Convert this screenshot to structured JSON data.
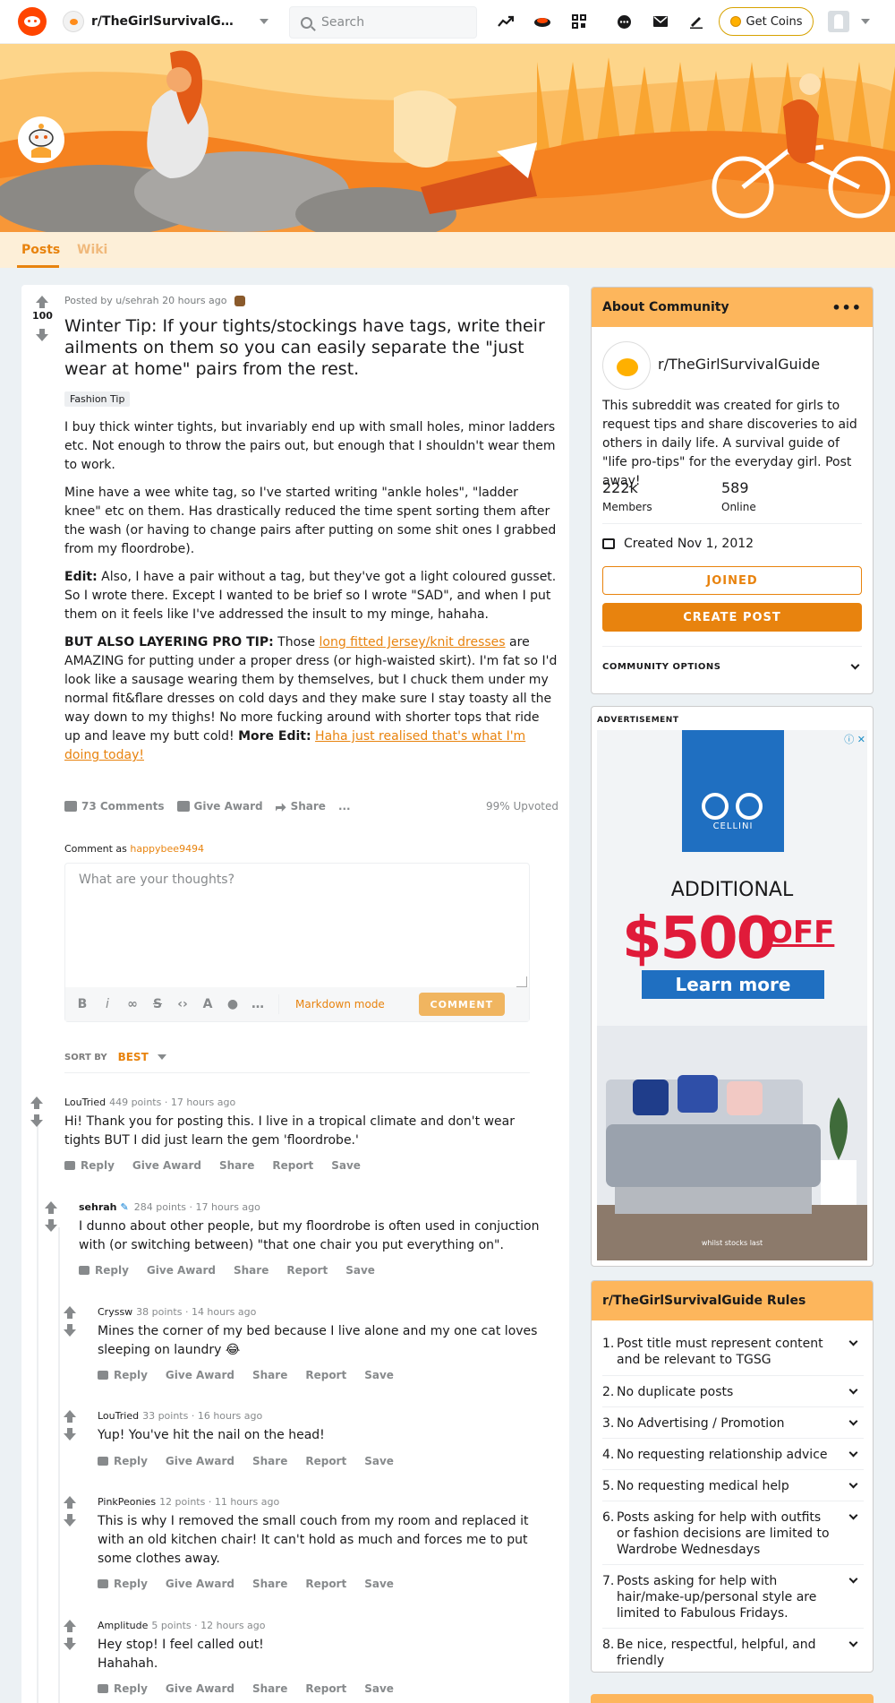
{
  "header": {
    "community": "r/TheGirlSurvivalGuide",
    "search_placeholder": "Search",
    "coins_label": "Get Coins"
  },
  "tabs": {
    "posts": "Posts",
    "wiki": "Wiki"
  },
  "post": {
    "score": "100",
    "posted_by": "Posted by u/sehrah 20 hours ago",
    "title": "Winter Tip: If your tights/stockings have tags, write their ailments on them so you can easily separate the \"just wear at home\" pairs from the rest.",
    "flair": "Fashion Tip",
    "p1": "I buy thick winter tights, but invariably end up with small holes, minor ladders etc. Not enough to throw the pairs out, but enough that I shouldn't wear them to work.",
    "p2": "Mine have a wee white tag, so I've started writing \"ankle holes\", \"ladder knee\" etc on them. Has drastically reduced the time spent sorting them after the wash (or having to change pairs after putting on some shit ones I grabbed from my floordrobe).",
    "p3_bold": "Edit:",
    "p3": " Also, I have a pair without a tag, but they've got a light coloured gusset. So I wrote there. Except I wanted to be brief so I wrote \"SAD\", and when I put them on it feels like I've addressed the insult to my minge, hahaha.",
    "p4_bold": "BUT ALSO LAYERING PRO TIP:",
    "p4_a": " Those ",
    "p4_link": "long fitted Jersey/knit dresses",
    "p4_b": " are AMAZING for putting under a proper dress (or high-waisted skirt). I'm fat so I'd look like a sausage wearing them by themselves, but I chuck them under my normal fit&flare dresses on cold days and they make sure I stay toasty all the way down to my thighs! No more fucking around with shorter tops that ride up and leave my butt cold! ",
    "p4_bold2": "More Edit:",
    "p4_link2": "Haha just realised that's what I'm doing today!",
    "comments_label": "73 Comments",
    "give_award": "Give Award",
    "share": "Share",
    "more": "...",
    "upvoted": "99% Upvoted"
  },
  "composer": {
    "comment_as": "Comment as ",
    "username": "happybee9494",
    "placeholder": "What are your thoughts?",
    "markdown": "Markdown mode",
    "submit": "COMMENT"
  },
  "sort": {
    "label": "SORT BY",
    "value": "BEST"
  },
  "comment_actions": {
    "reply": "Reply",
    "award": "Give Award",
    "share": "Share",
    "report": "Report",
    "save": "Save"
  },
  "comments": [
    {
      "author": "LouTried",
      "meta": "449 points · 17 hours ago",
      "lines": [
        "Hi! Thank you for posting this. I live in a tropical climate and don't wear",
        "tights BUT I did just learn the gem 'floordrobe.'"
      ]
    },
    {
      "author": "sehrah",
      "meta": "284 points · 17 hours ago",
      "lines": [
        "I dunno about other people, but my floordrobe is often used in conjuction",
        "with (or switching between) \"that one chair you put everything on\"."
      ]
    },
    {
      "author": "Cryssw",
      "meta": "38 points · 14 hours ago",
      "lines": [
        "Mines the corner of my bed because I live alone and my one cat loves",
        "sleeping on laundry 😂"
      ]
    },
    {
      "author": "LouTried",
      "meta": "33 points · 16 hours ago",
      "lines": [
        "Yup! You've hit the nail on the head!"
      ]
    },
    {
      "author": "PinkPeonies",
      "meta": "12 points · 11 hours ago",
      "lines": [
        "This is why I removed the small couch from my room and replaced it",
        "with an old kitchen chair! It can't hold as much and forces me to put",
        "some clothes away."
      ]
    },
    {
      "author": "Amplitude",
      "meta": "5 points · 12 hours ago",
      "lines": [
        "Hey stop! I feel called out!",
        "Hahahah."
      ]
    }
  ],
  "about": {
    "title": "About Community",
    "name": "r/TheGirlSurvivalGuide",
    "description": "This subreddit was created for girls to request tips and share discoveries to aid others in daily life. A survival guide of \"life pro-tips\" for the everyday girl. Post away!",
    "members": "222k",
    "members_label": "Members",
    "online": "589",
    "online_label": "Online",
    "created": "Created Nov 1, 2012",
    "joined": "JOINED",
    "create_post": "CREATE POST",
    "options": "COMMUNITY OPTIONS"
  },
  "ad": {
    "label": "ADVERTISEMENT",
    "brand": "CELLINI",
    "additional": "ADDITIONAL",
    "price": "$500",
    "off": "OFF",
    "cta": "Learn more",
    "fine": "whilst stocks last"
  },
  "rules": {
    "title": "r/TheGirlSurvivalGuide Rules",
    "items": [
      "Post title must represent content and be relevant to TGSG",
      "No duplicate posts",
      "No Advertising / Promotion",
      "No requesting relationship advice",
      "No requesting medical help",
      "Posts asking for help with outfits or fashion decisions are limited to Wardrobe Wednesdays",
      "Posts asking for help with hair/make-up/personal style are limited to Fabulous Fridays.",
      "Be nice, respectful, helpful, and friendly"
    ]
  },
  "colors": {
    "accent": "#e8830e",
    "banner": "#fdb44f",
    "header_box": "#fdb65c"
  }
}
